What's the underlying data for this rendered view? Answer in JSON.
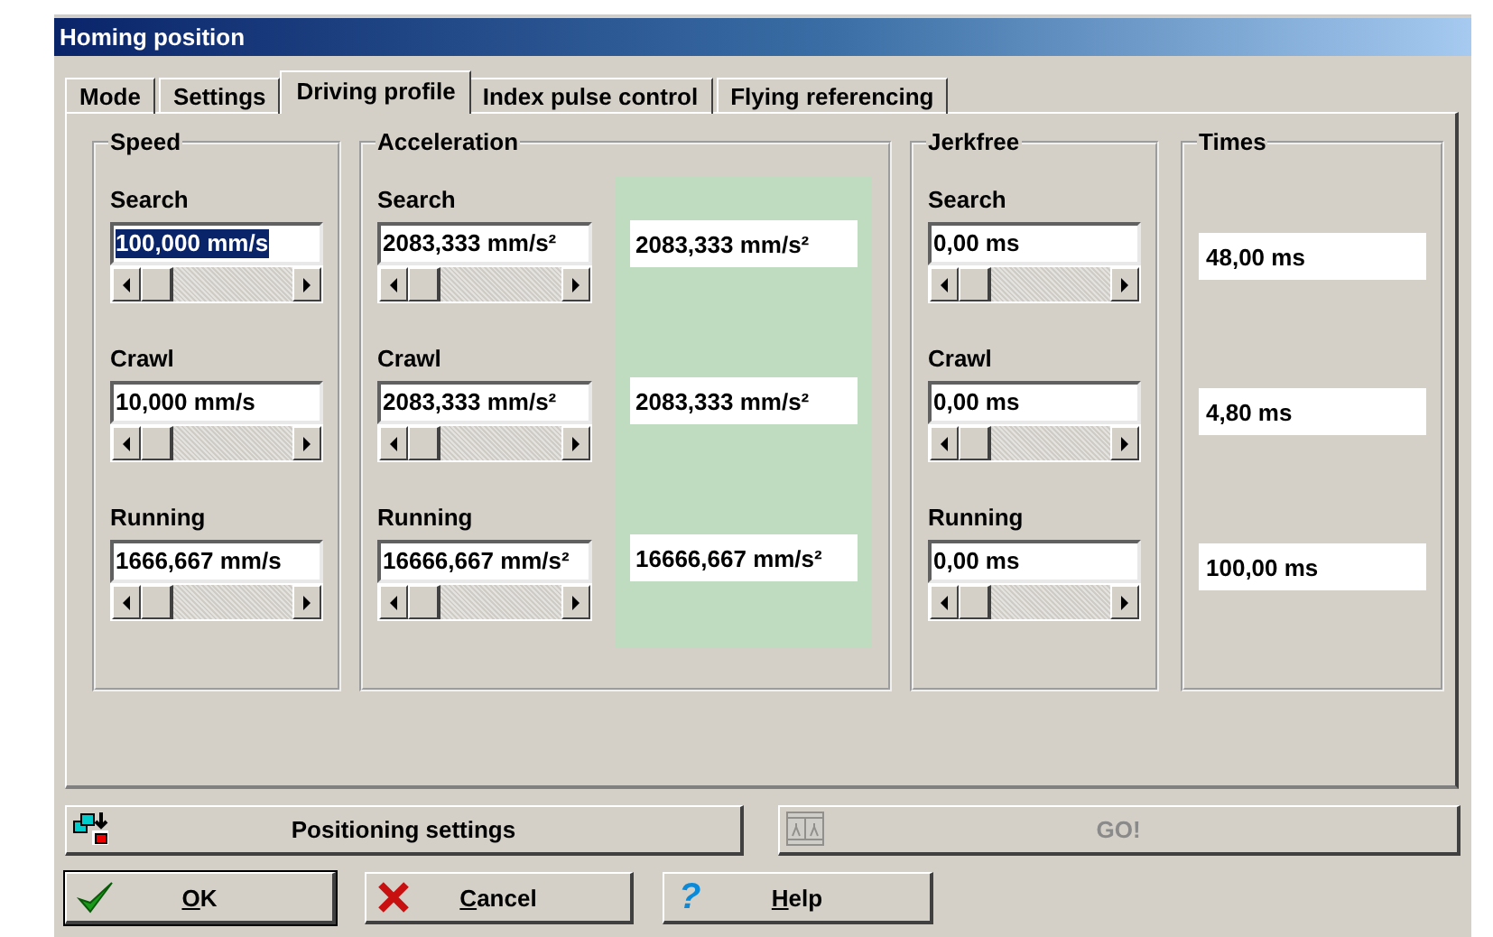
{
  "window": {
    "title": "Homing position"
  },
  "tabs": [
    {
      "label": "Mode",
      "selected": false
    },
    {
      "label": "Settings",
      "selected": false
    },
    {
      "label": "Driving profile",
      "selected": true
    },
    {
      "label": "Index pulse control",
      "selected": false
    },
    {
      "label": "Flying referencing",
      "selected": false
    }
  ],
  "groups": [
    {
      "title": "Speed",
      "kind": "sliders",
      "rows": [
        {
          "label": "Search",
          "value": "100,000 mm/s",
          "text_selected": true
        },
        {
          "label": "Crawl",
          "value": "10,000 mm/s",
          "text_selected": false
        },
        {
          "label": "Running",
          "value": "1666,667 mm/s",
          "text_selected": false
        }
      ]
    },
    {
      "title": "Acceleration",
      "kind": "sliders",
      "rows": [
        {
          "label": "Search",
          "value": "2083,333 mm/s²",
          "text_selected": false
        },
        {
          "label": "Crawl",
          "value": "2083,333 mm/s²",
          "text_selected": false
        },
        {
          "label": "Running",
          "value": "16666,667 mm/s²",
          "text_selected": false
        }
      ],
      "results": [
        "2083,333 mm/s²",
        "2083,333 mm/s²",
        "16666,667 mm/s²"
      ]
    },
    {
      "title": "Jerkfree",
      "kind": "sliders",
      "rows": [
        {
          "label": "Search",
          "value": "0,00 ms",
          "text_selected": false
        },
        {
          "label": "Crawl",
          "value": "0,00 ms",
          "text_selected": false
        },
        {
          "label": "Running",
          "value": "0,00 ms",
          "text_selected": false
        }
      ]
    },
    {
      "title": "Times",
      "kind": "readouts",
      "values": [
        "48,00 ms",
        "4,80 ms",
        "100,00 ms"
      ]
    }
  ],
  "actions": [
    {
      "label": "Positioning settings",
      "kind": "positioning",
      "disabled": false
    },
    {
      "label": "GO!",
      "kind": "go",
      "disabled": true
    }
  ],
  "buttons": [
    {
      "mnemonic": "O",
      "rest": "K",
      "kind": "ok",
      "default": true
    },
    {
      "mnemonic": "C",
      "rest": "ancel",
      "kind": "cancel",
      "default": false
    },
    {
      "mnemonic": "H",
      "rest": "elp",
      "kind": "help",
      "default": false,
      "glyph": "?"
    }
  ]
}
